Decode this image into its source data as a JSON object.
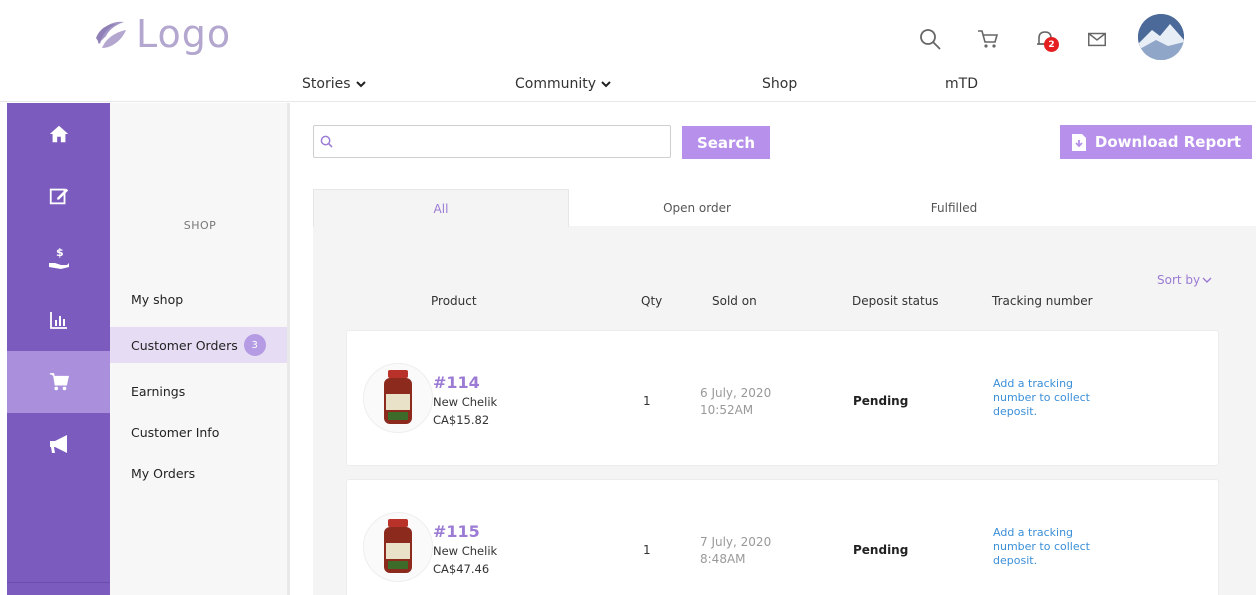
{
  "header": {
    "logo_text": "Logo",
    "notification_count": "2",
    "icons": [
      "search-icon",
      "cart-icon",
      "bell-icon",
      "mail-icon",
      "avatar"
    ]
  },
  "topnav": {
    "items": [
      {
        "label": "Stories",
        "dropdown": true
      },
      {
        "label": "Community",
        "dropdown": true
      },
      {
        "label": "Shop",
        "dropdown": false
      },
      {
        "label": "mTD",
        "dropdown": false
      }
    ]
  },
  "sidebar": {
    "icons": [
      "home-icon",
      "edit-icon",
      "money-hand-icon",
      "chart-icon",
      "cart-icon",
      "megaphone-icon"
    ],
    "active_icon": "cart-icon",
    "section_title": "SHOP",
    "items": [
      {
        "label": "My shop"
      },
      {
        "label": "Customer Orders",
        "count": "3"
      },
      {
        "label": "Earnings"
      },
      {
        "label": "Customer Info"
      },
      {
        "label": "My Orders"
      }
    ],
    "active_item": "Customer Orders"
  },
  "toolbar": {
    "search_placeholder": "",
    "search_label": "Search",
    "download_label": "Download Report"
  },
  "tabs": [
    {
      "label": "All",
      "active": true
    },
    {
      "label": "Open order",
      "active": false
    },
    {
      "label": "Fulfilled",
      "active": false
    }
  ],
  "sort_label": "Sort by",
  "table": {
    "columns": [
      "Product",
      "Qty",
      "Sold on",
      "Deposit status",
      "Tracking number"
    ],
    "rows": [
      {
        "id": "#114",
        "name": "New Chelik",
        "price": "CA$15.82",
        "qty": "1",
        "date": "6 July, 2020",
        "time": "10:52AM",
        "deposit": "Pending",
        "tracking": "Add a tracking number to collect deposit."
      },
      {
        "id": "#115",
        "name": "New Chelik",
        "price": "CA$47.46",
        "qty": "1",
        "date": "7 July, 2020",
        "time": "8:48AM",
        "deposit": "Pending",
        "tracking": "Add a tracking number to collect deposit."
      }
    ]
  },
  "colors": {
    "accent": "#b690ea",
    "sidebar_bg": "#7b5bbd",
    "sidebar_active": "#a98fdc",
    "link": "#3b8fd8",
    "badge": "#e51f1f"
  }
}
